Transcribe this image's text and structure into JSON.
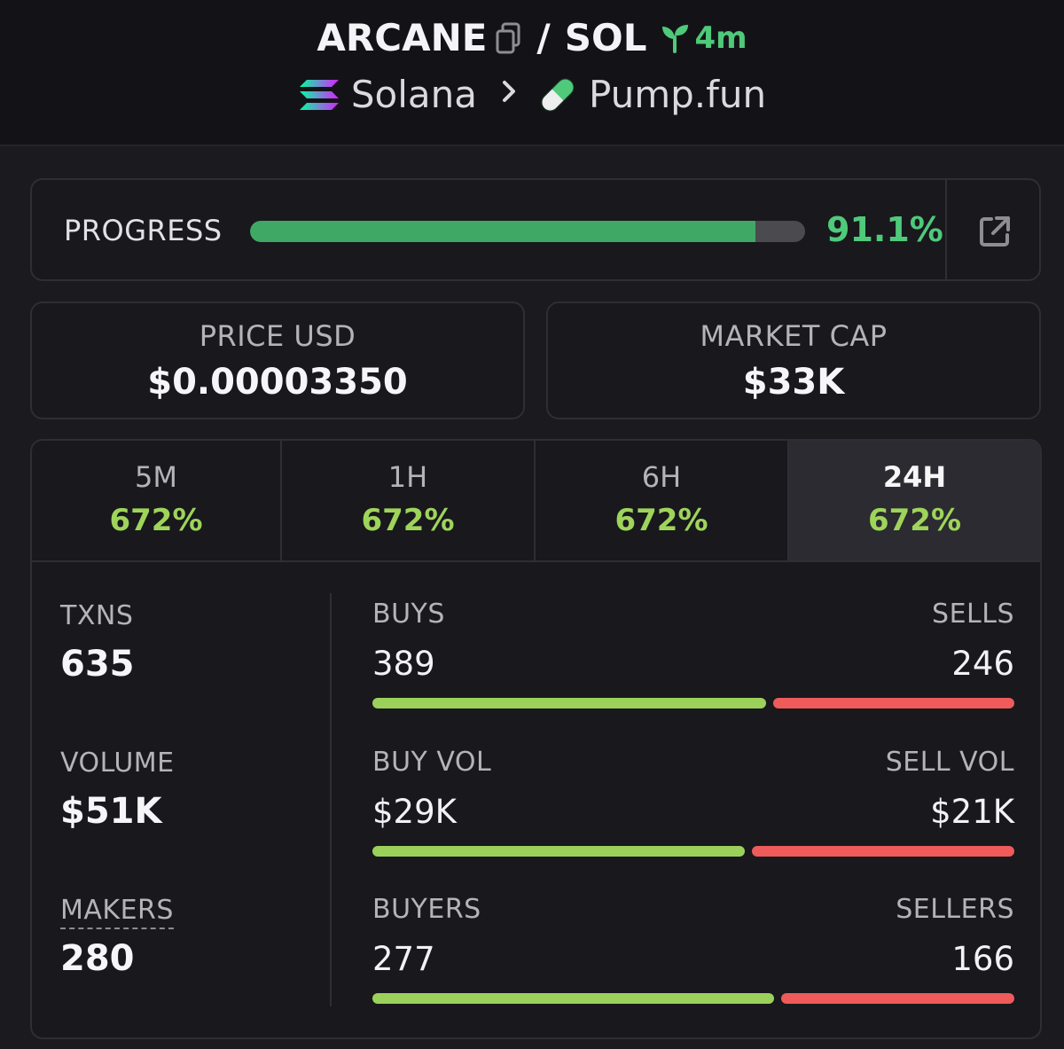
{
  "header": {
    "token": "ARCANE",
    "separator": "/",
    "quote": "SOL",
    "age": "4m",
    "chain": "Solana",
    "dex": "Pump.fun",
    "icons": {
      "copy": "copy-icon",
      "age": "sprout-icon",
      "chain": "solana-logo-icon",
      "dex": "pill-icon",
      "breadcrumb": "chevron-right-icon"
    }
  },
  "progress": {
    "label": "PROGRESS",
    "percent_text": "91.1%",
    "fraction": 0.911,
    "external_icon": "external-link-icon"
  },
  "price": {
    "label": "PRICE USD",
    "value": "$0.00003350"
  },
  "market_cap": {
    "label": "MARKET CAP",
    "value": "$33K"
  },
  "tabs": [
    {
      "name": "5M",
      "value": "672%"
    },
    {
      "name": "1H",
      "value": "672%"
    },
    {
      "name": "6H",
      "value": "672%"
    },
    {
      "name": "24H",
      "value": "672%",
      "active": true
    }
  ],
  "metrics": {
    "txns": {
      "label": "TXNS",
      "value": "635"
    },
    "volume": {
      "label": "VOLUME",
      "value": "$51K"
    },
    "makers": {
      "label": "MAKERS",
      "value": "280"
    }
  },
  "splits": {
    "txns": {
      "buy_label": "BUYS",
      "sell_label": "SELLS",
      "buy_value": "389",
      "sell_value": "246",
      "buy_share": 0.613
    },
    "volume": {
      "buy_label": "BUY VOL",
      "sell_label": "SELL VOL",
      "buy_value": "$29K",
      "sell_value": "$21K",
      "buy_share": 0.58
    },
    "makers": {
      "buy_label": "BUYERS",
      "sell_label": "SELLERS",
      "buy_value": "277",
      "sell_value": "166",
      "buy_share": 0.625
    }
  },
  "colors": {
    "accent_green": "#4fc97a",
    "change_green": "#9fd45a",
    "buy_bar": "#9bd15a",
    "sell_bar": "#ef5a5a",
    "progress_fill": "#3fa865"
  }
}
